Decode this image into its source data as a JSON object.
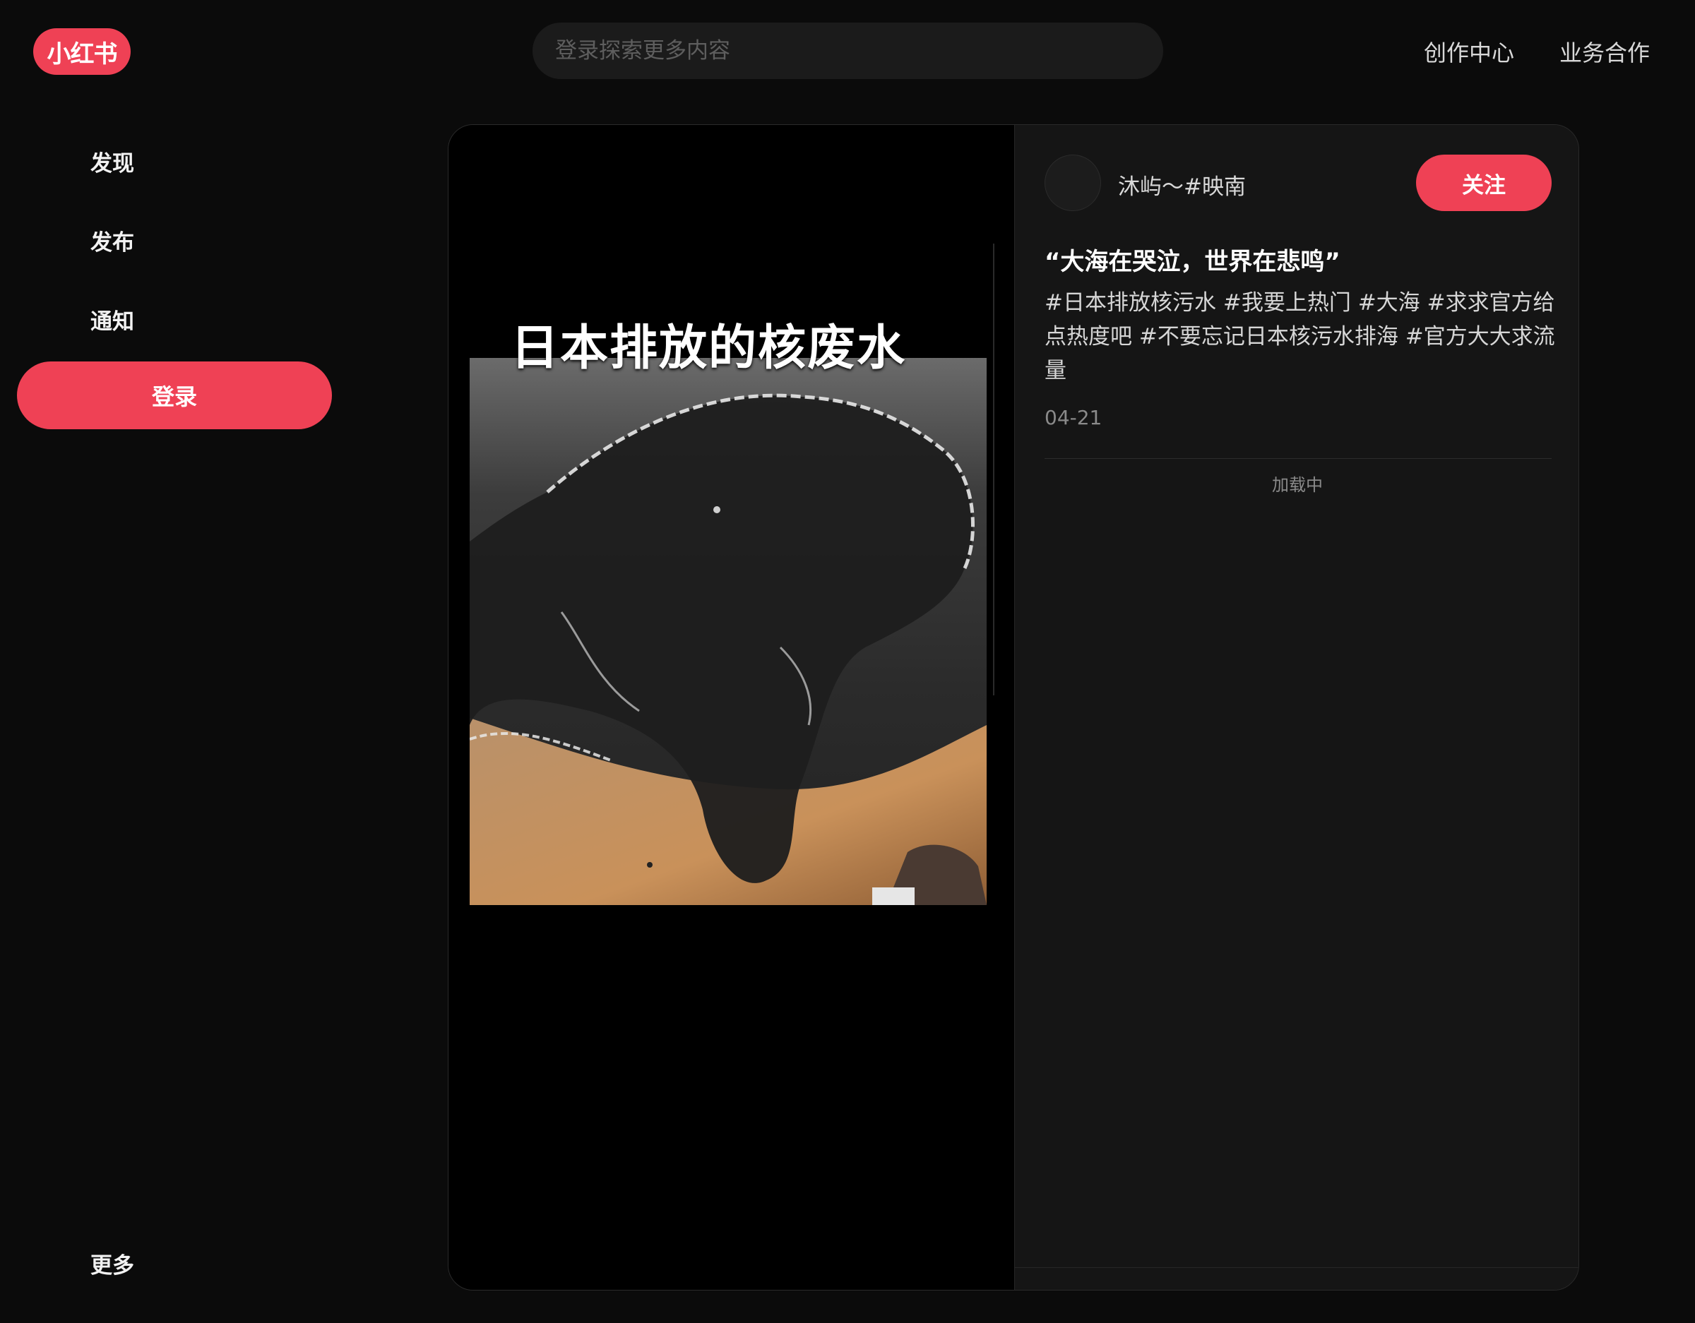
{
  "header": {
    "logo_text": "小红书",
    "search_placeholder": "登录探索更多内容",
    "links": [
      "创作中心",
      "业务合作"
    ]
  },
  "sidebar": {
    "items": [
      "发现",
      "发布",
      "通知"
    ],
    "login_label": "登录",
    "more_label": "更多"
  },
  "note": {
    "media_overlay_text": "日本排放的核废水",
    "author": {
      "name": "沐屿～#映南",
      "follow_label": "关注"
    },
    "title": "“大海在哭泣，世界在悲鸣”",
    "tags": [
      "#日本排放核污水",
      "#我要上热门",
      "#大海",
      "#求求官方给点热度吧",
      "#不要忘记日本核污水排海",
      "#官方大大求流量"
    ],
    "date": "04-21",
    "comments_status": "加载中"
  },
  "colors": {
    "brand": "#ef4155",
    "background": "#0b0b0b",
    "card": "#141414"
  }
}
